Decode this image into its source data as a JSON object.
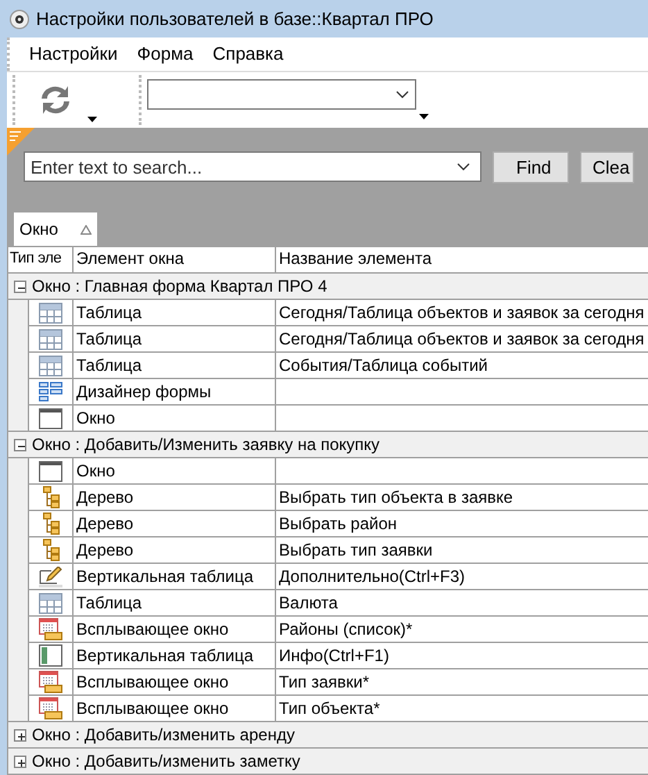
{
  "window": {
    "title": "Настройки пользователей в базе::Квартал ПРО"
  },
  "menu": [
    "Настройки",
    "Форма",
    "Справка"
  ],
  "search": {
    "placeholder": "Enter text to search...",
    "buttons": [
      "Find",
      "Clea"
    ]
  },
  "group_by": {
    "label": "Окно"
  },
  "table": {
    "columns": [
      "Тип эле",
      "Элемент окна",
      "Название элемента"
    ],
    "groups": [
      {
        "title": "Окно : Главная форма Квартал ПРО 4",
        "expanded": true,
        "rows": [
          {
            "kind": "grid",
            "element": "Таблица",
            "name": "Сегодня/Таблица объектов и заявок за сегодня"
          },
          {
            "kind": "grid",
            "element": "Таблица",
            "name": "Сегодня/Таблица объектов и заявок за сегодня"
          },
          {
            "kind": "grid",
            "element": "Таблица",
            "name": "События/Таблица событий"
          },
          {
            "kind": "designer",
            "element": "Дизайнер формы"
          },
          {
            "kind": "window",
            "element": "Окно"
          }
        ]
      },
      {
        "title": "Окно : Добавить/Изменить заявку на покупку",
        "expanded": true,
        "rows": [
          {
            "kind": "window",
            "element": "Окно"
          },
          {
            "kind": "tree",
            "element": "Дерево",
            "name": "Выбрать тип объекта в заявке"
          },
          {
            "kind": "tree",
            "element": "Дерево",
            "name": "Выбрать район"
          },
          {
            "kind": "tree",
            "element": "Дерево",
            "name": "Выбрать тип заявки"
          },
          {
            "kind": "edit",
            "element": "Вертикальная таблица",
            "name": "Дополнительно(Ctrl+F3)"
          },
          {
            "kind": "grid",
            "element": "Таблица",
            "name": "Валюта"
          },
          {
            "kind": "popup",
            "element": "Всплывающее окно",
            "name": "Районы (список)*"
          },
          {
            "kind": "vtable",
            "element": "Вертикальная таблица",
            "name": "Инфо(Ctrl+F1)"
          },
          {
            "kind": "popup",
            "element": "Всплывающее окно",
            "name": "Тип заявки*"
          },
          {
            "kind": "popup",
            "element": "Всплывающее окно",
            "name": "Тип объекта*"
          }
        ]
      },
      {
        "title": "Окно : Добавить/изменить аренду",
        "expanded": false
      },
      {
        "title": "Окно : Добавить/изменить заметку",
        "expanded": false
      }
    ]
  }
}
